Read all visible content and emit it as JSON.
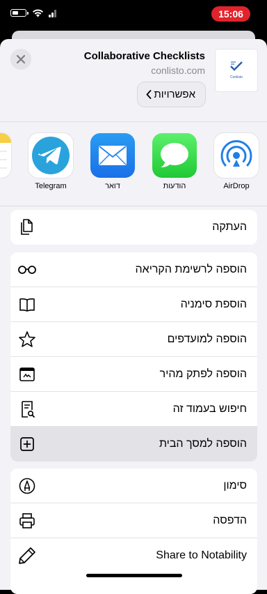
{
  "status_bar": {
    "time": "15:06",
    "icons": [
      "battery-icon",
      "wifi-icon",
      "signal-icon"
    ],
    "time_badge_color": "#e0242c"
  },
  "share_header": {
    "title": "Collaborative Checklists",
    "domain": "conlisto.com",
    "options_label": "אפשרויות",
    "thumbnail_caption": "Conlisto"
  },
  "apps": [
    {
      "label": "AirDrop",
      "icon": "airdrop-icon"
    },
    {
      "label": "הודעות",
      "icon": "messages-icon"
    },
    {
      "label": "דואר",
      "icon": "mail-icon"
    },
    {
      "label": "Telegram",
      "icon": "telegram-icon"
    },
    {
      "label": "",
      "icon": "notes-icon"
    }
  ],
  "actions": {
    "group1": [
      {
        "label": "העתקה",
        "icon": "copy-icon"
      }
    ],
    "group2": [
      {
        "label": "הוספה לרשימת הקריאה",
        "icon": "reading-list-icon"
      },
      {
        "label": "הוספת סימניה",
        "icon": "bookmark-icon"
      },
      {
        "label": "הוספה למועדפים",
        "icon": "favorites-star-icon"
      },
      {
        "label": "הוספה לפתק מהיר",
        "icon": "quick-note-icon"
      },
      {
        "label": "חיפוש בעמוד זה",
        "icon": "find-on-page-icon"
      },
      {
        "label": "הוספה למסך הבית",
        "icon": "add-to-home-icon",
        "highlighted": true
      }
    ],
    "group3": [
      {
        "label": "סימון",
        "icon": "markup-icon"
      },
      {
        "label": "הדפסה",
        "icon": "print-icon"
      },
      {
        "label": "Share to Notability",
        "icon": "pencil-icon"
      }
    ]
  }
}
